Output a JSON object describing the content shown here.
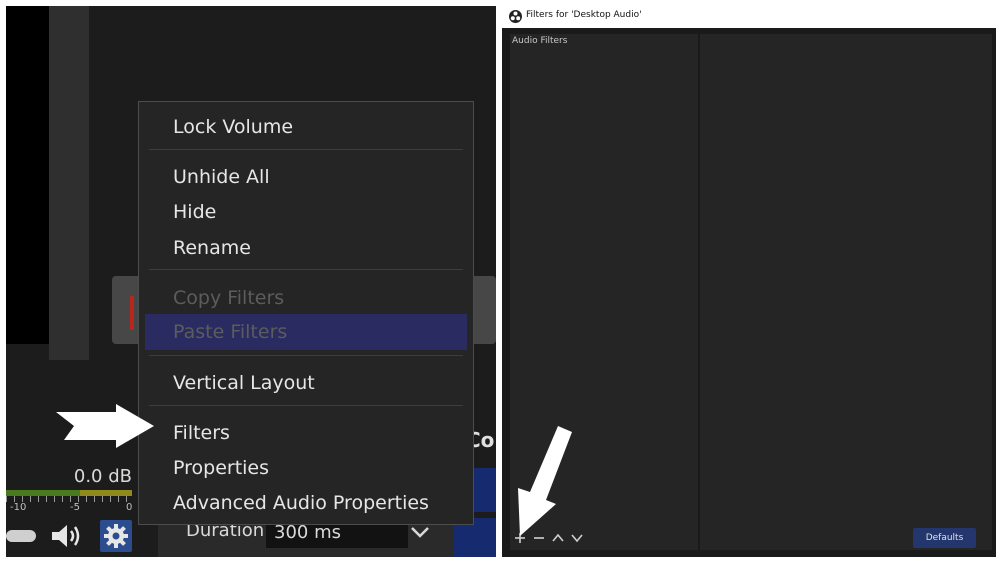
{
  "context_menu": {
    "items": [
      {
        "label": "Lock Volume",
        "disabled": false
      },
      {
        "label": "Unhide All",
        "disabled": false
      },
      {
        "label": "Hide",
        "disabled": false
      },
      {
        "label": "Rename",
        "disabled": false
      },
      {
        "label": "Copy Filters",
        "disabled": true
      },
      {
        "label": "Paste Filters",
        "disabled": true,
        "highlighted": true
      },
      {
        "label": "Vertical Layout",
        "disabled": false
      },
      {
        "label": "Filters",
        "disabled": false
      },
      {
        "label": "Properties",
        "disabled": false
      },
      {
        "label": "Advanced Audio Properties",
        "disabled": false
      }
    ]
  },
  "mixer": {
    "db_value": "0.0 dB",
    "tick_labels": [
      "-10",
      "-5",
      "0"
    ],
    "icons": [
      "speaker-icon",
      "gear-icon"
    ]
  },
  "transition": {
    "duration_label": "Duration",
    "duration_value": "300 ms",
    "controls_heading": "Cor"
  },
  "filters_window": {
    "title": "Filters for 'Desktop Audio'",
    "audio_filters_label": "Audio Filters",
    "defaults_button": "Defaults",
    "toolbar_icons": [
      "plus-icon",
      "minus-icon",
      "chevron-up-icon",
      "chevron-down-icon"
    ]
  },
  "colors": {
    "menu_highlight": "#292b61",
    "gear_button": "#2b4d8f",
    "defaults_button": "#23376e"
  }
}
